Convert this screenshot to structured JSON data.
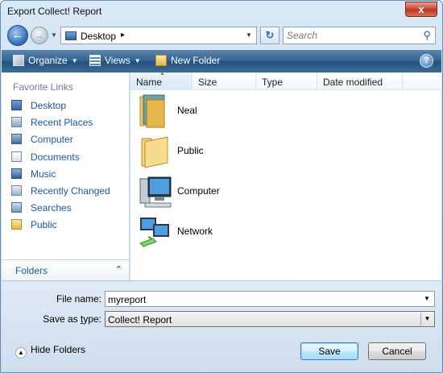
{
  "window": {
    "title": "Export Collect! Report",
    "close_glyph": "x"
  },
  "address_bar": {
    "location": "Desktop",
    "separator": "▸",
    "search_placeholder": "Search"
  },
  "toolbar": {
    "organize": "Organize",
    "views": "Views",
    "new_folder": "New Folder",
    "help": "?"
  },
  "sidebar": {
    "title": "Favorite Links",
    "items": [
      {
        "label": "Desktop",
        "icon": "desktop-icon"
      },
      {
        "label": "Recent Places",
        "icon": "recent-places-icon"
      },
      {
        "label": "Computer",
        "icon": "computer-icon"
      },
      {
        "label": "Documents",
        "icon": "documents-icon"
      },
      {
        "label": "Music",
        "icon": "music-icon"
      },
      {
        "label": "Recently Changed",
        "icon": "recently-changed-icon"
      },
      {
        "label": "Searches",
        "icon": "searches-icon"
      },
      {
        "label": "Public",
        "icon": "public-folder-icon"
      }
    ],
    "folders_label": "Folders"
  },
  "file_list": {
    "columns": [
      "Name",
      "Size",
      "Type",
      "Date modified"
    ],
    "items": [
      {
        "label": "Neal",
        "icon": "user-folder-icon"
      },
      {
        "label": "Public",
        "icon": "folder-icon"
      },
      {
        "label": "Computer",
        "icon": "computer-icon"
      },
      {
        "label": "Network",
        "icon": "network-icon"
      }
    ]
  },
  "form": {
    "file_name_label": "File name:",
    "file_name_value": "myreport",
    "save_type_label": "Save as type:",
    "save_type_value": "Collect! Report"
  },
  "footer": {
    "hide_folders": "Hide Folders",
    "save": "Save",
    "cancel": "Cancel"
  }
}
